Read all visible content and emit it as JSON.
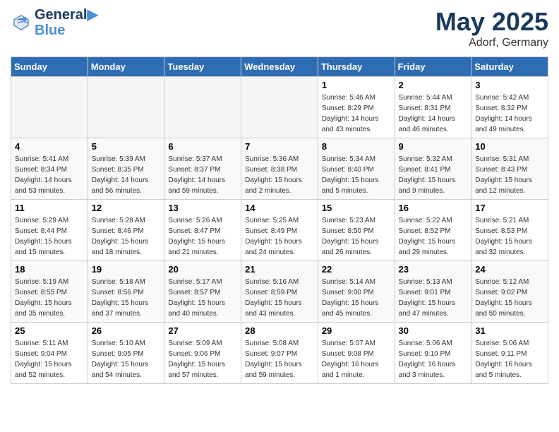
{
  "header": {
    "logo_line1": "General",
    "logo_line2": "Blue",
    "month": "May 2025",
    "location": "Adorf, Germany"
  },
  "days_of_week": [
    "Sunday",
    "Monday",
    "Tuesday",
    "Wednesday",
    "Thursday",
    "Friday",
    "Saturday"
  ],
  "weeks": [
    [
      {
        "day": "",
        "info": ""
      },
      {
        "day": "",
        "info": ""
      },
      {
        "day": "",
        "info": ""
      },
      {
        "day": "",
        "info": ""
      },
      {
        "day": "1",
        "info": "Sunrise: 5:46 AM\nSunset: 8:29 PM\nDaylight: 14 hours\nand 43 minutes."
      },
      {
        "day": "2",
        "info": "Sunrise: 5:44 AM\nSunset: 8:31 PM\nDaylight: 14 hours\nand 46 minutes."
      },
      {
        "day": "3",
        "info": "Sunrise: 5:42 AM\nSunset: 8:32 PM\nDaylight: 14 hours\nand 49 minutes."
      }
    ],
    [
      {
        "day": "4",
        "info": "Sunrise: 5:41 AM\nSunset: 8:34 PM\nDaylight: 14 hours\nand 53 minutes."
      },
      {
        "day": "5",
        "info": "Sunrise: 5:39 AM\nSunset: 8:35 PM\nDaylight: 14 hours\nand 56 minutes."
      },
      {
        "day": "6",
        "info": "Sunrise: 5:37 AM\nSunset: 8:37 PM\nDaylight: 14 hours\nand 59 minutes."
      },
      {
        "day": "7",
        "info": "Sunrise: 5:36 AM\nSunset: 8:38 PM\nDaylight: 15 hours\nand 2 minutes."
      },
      {
        "day": "8",
        "info": "Sunrise: 5:34 AM\nSunset: 8:40 PM\nDaylight: 15 hours\nand 5 minutes."
      },
      {
        "day": "9",
        "info": "Sunrise: 5:32 AM\nSunset: 8:41 PM\nDaylight: 15 hours\nand 9 minutes."
      },
      {
        "day": "10",
        "info": "Sunrise: 5:31 AM\nSunset: 8:43 PM\nDaylight: 15 hours\nand 12 minutes."
      }
    ],
    [
      {
        "day": "11",
        "info": "Sunrise: 5:29 AM\nSunset: 8:44 PM\nDaylight: 15 hours\nand 15 minutes."
      },
      {
        "day": "12",
        "info": "Sunrise: 5:28 AM\nSunset: 8:46 PM\nDaylight: 15 hours\nand 18 minutes."
      },
      {
        "day": "13",
        "info": "Sunrise: 5:26 AM\nSunset: 8:47 PM\nDaylight: 15 hours\nand 21 minutes."
      },
      {
        "day": "14",
        "info": "Sunrise: 5:25 AM\nSunset: 8:49 PM\nDaylight: 15 hours\nand 24 minutes."
      },
      {
        "day": "15",
        "info": "Sunrise: 5:23 AM\nSunset: 8:50 PM\nDaylight: 15 hours\nand 26 minutes."
      },
      {
        "day": "16",
        "info": "Sunrise: 5:22 AM\nSunset: 8:52 PM\nDaylight: 15 hours\nand 29 minutes."
      },
      {
        "day": "17",
        "info": "Sunrise: 5:21 AM\nSunset: 8:53 PM\nDaylight: 15 hours\nand 32 minutes."
      }
    ],
    [
      {
        "day": "18",
        "info": "Sunrise: 5:19 AM\nSunset: 8:55 PM\nDaylight: 15 hours\nand 35 minutes."
      },
      {
        "day": "19",
        "info": "Sunrise: 5:18 AM\nSunset: 8:56 PM\nDaylight: 15 hours\nand 37 minutes."
      },
      {
        "day": "20",
        "info": "Sunrise: 5:17 AM\nSunset: 8:57 PM\nDaylight: 15 hours\nand 40 minutes."
      },
      {
        "day": "21",
        "info": "Sunrise: 5:16 AM\nSunset: 8:59 PM\nDaylight: 15 hours\nand 43 minutes."
      },
      {
        "day": "22",
        "info": "Sunrise: 5:14 AM\nSunset: 9:00 PM\nDaylight: 15 hours\nand 45 minutes."
      },
      {
        "day": "23",
        "info": "Sunrise: 5:13 AM\nSunset: 9:01 PM\nDaylight: 15 hours\nand 47 minutes."
      },
      {
        "day": "24",
        "info": "Sunrise: 5:12 AM\nSunset: 9:02 PM\nDaylight: 15 hours\nand 50 minutes."
      }
    ],
    [
      {
        "day": "25",
        "info": "Sunrise: 5:11 AM\nSunset: 9:04 PM\nDaylight: 15 hours\nand 52 minutes."
      },
      {
        "day": "26",
        "info": "Sunrise: 5:10 AM\nSunset: 9:05 PM\nDaylight: 15 hours\nand 54 minutes."
      },
      {
        "day": "27",
        "info": "Sunrise: 5:09 AM\nSunset: 9:06 PM\nDaylight: 15 hours\nand 57 minutes."
      },
      {
        "day": "28",
        "info": "Sunrise: 5:08 AM\nSunset: 9:07 PM\nDaylight: 15 hours\nand 59 minutes."
      },
      {
        "day": "29",
        "info": "Sunrise: 5:07 AM\nSunset: 9:08 PM\nDaylight: 16 hours\nand 1 minute."
      },
      {
        "day": "30",
        "info": "Sunrise: 5:06 AM\nSunset: 9:10 PM\nDaylight: 16 hours\nand 3 minutes."
      },
      {
        "day": "31",
        "info": "Sunrise: 5:06 AM\nSunset: 9:11 PM\nDaylight: 16 hours\nand 5 minutes."
      }
    ]
  ]
}
